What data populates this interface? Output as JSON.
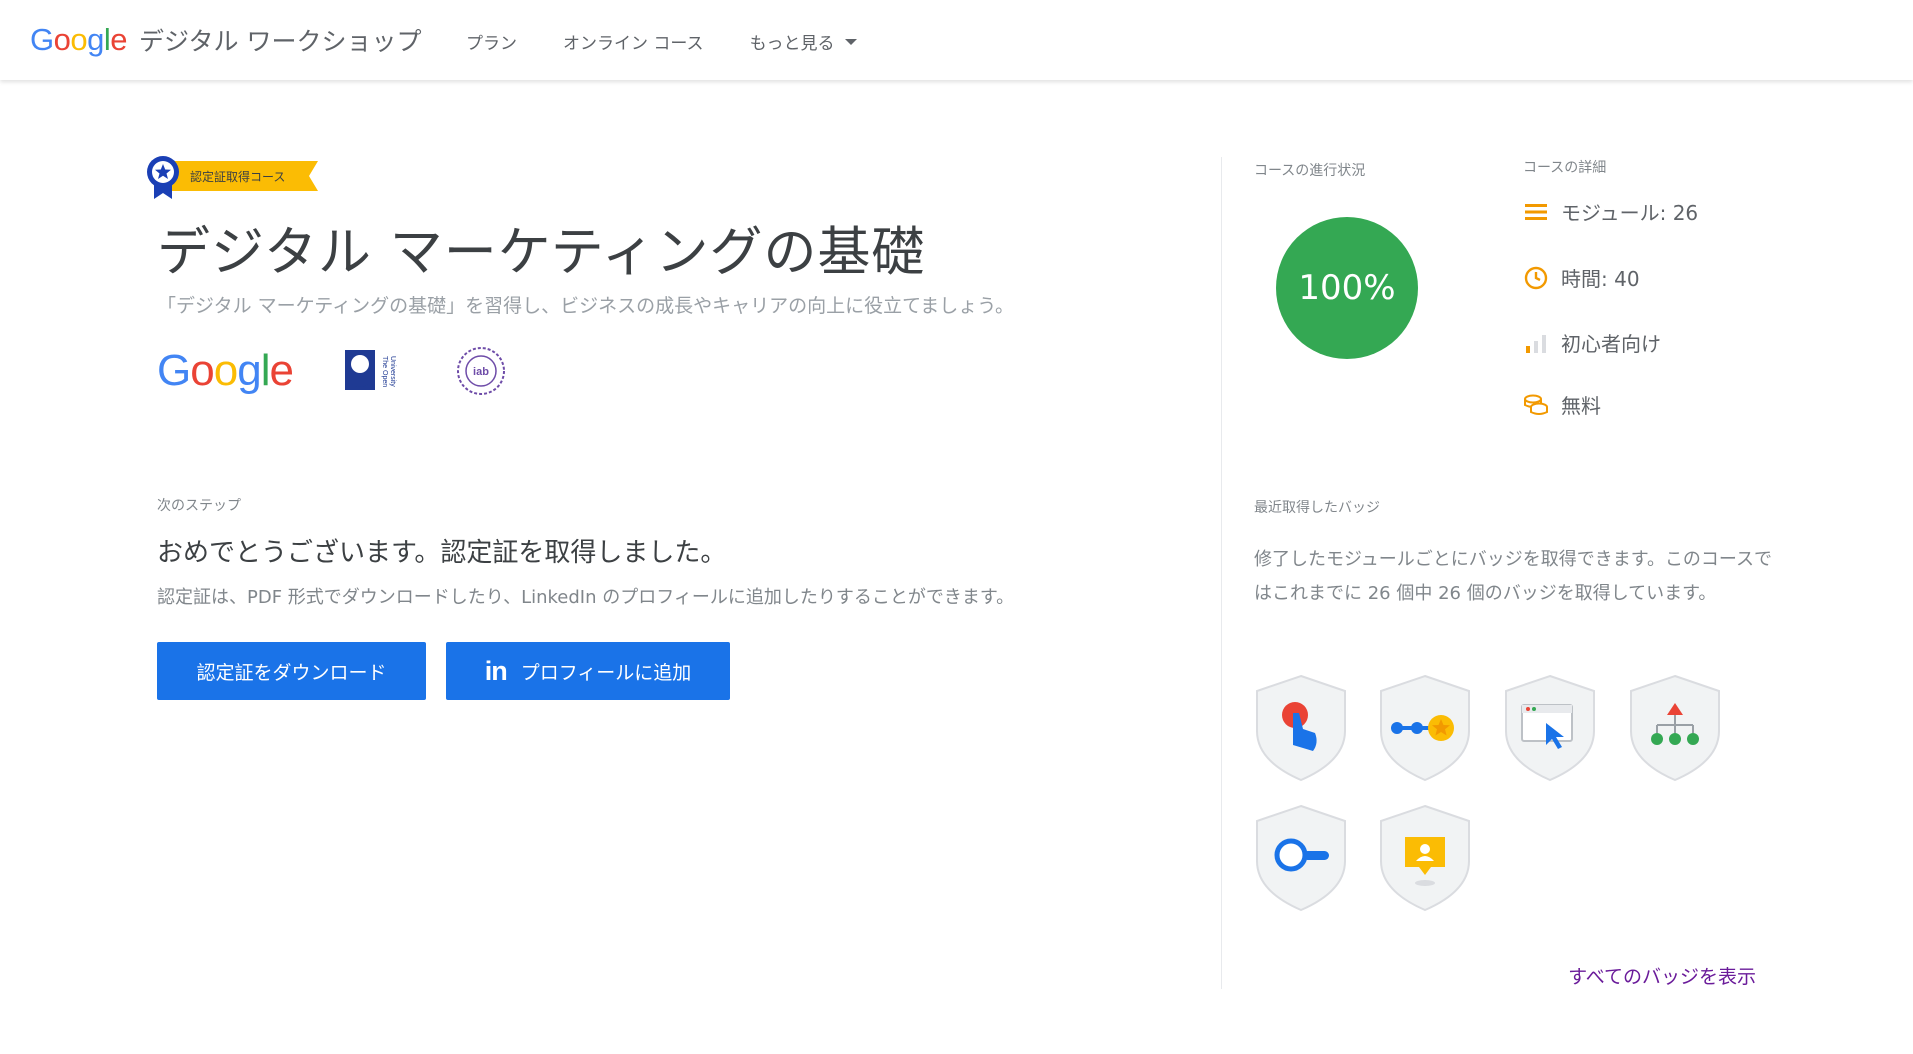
{
  "header": {
    "logo": "Google",
    "brand": "デジタル ワークショップ",
    "nav": [
      "プラン",
      "オンライン コース",
      "もっと見る"
    ]
  },
  "course": {
    "ribbon": "認定証取得コース",
    "title": "デジタル マーケティングの基礎",
    "subtitle": "「デジタル マーケティングの基礎」を習得し、ビジネスの成長やキャリアの向上に役立てましょう。",
    "partners": {
      "google": "Google",
      "open_university": "The Open University",
      "iab": "iab"
    }
  },
  "next_steps": {
    "label": "次のステップ",
    "heading": "おめでとうございます。認定証を取得しました。",
    "description": "認定証は、PDF 形式でダウンロードしたり、LinkedIn のプロフィールに追加したりすることができます。",
    "download_button": "認定証をダウンロード",
    "linkedin_button": "プロフィールに追加",
    "linkedin_icon_text": "in"
  },
  "progress": {
    "label": "コースの進行状況",
    "value": "100%"
  },
  "details": {
    "label": "コースの詳細",
    "modules": "モジュール: 26",
    "hours": "時間: 40",
    "level": "初心者向け",
    "price": "無料"
  },
  "badges": {
    "label": "最近取得したバッジ",
    "description": "修了したモジュールごとにバッジを取得できます。このコースではこれまでに 26 個中 26 個のバッジを取得しています。",
    "see_all": "すべてのバッジを表示",
    "icons": [
      "tap-badge-icon",
      "path-star-badge-icon",
      "browser-cursor-badge-icon",
      "hierarchy-badge-icon",
      "search-badge-icon",
      "profile-pin-badge-icon"
    ]
  },
  "colors": {
    "google_blue": "#4285f4",
    "google_red": "#ea4335",
    "google_yellow": "#fbbc04",
    "google_green": "#34a853",
    "button_blue": "#1a73e8",
    "link_purple": "#6a1b9a"
  }
}
